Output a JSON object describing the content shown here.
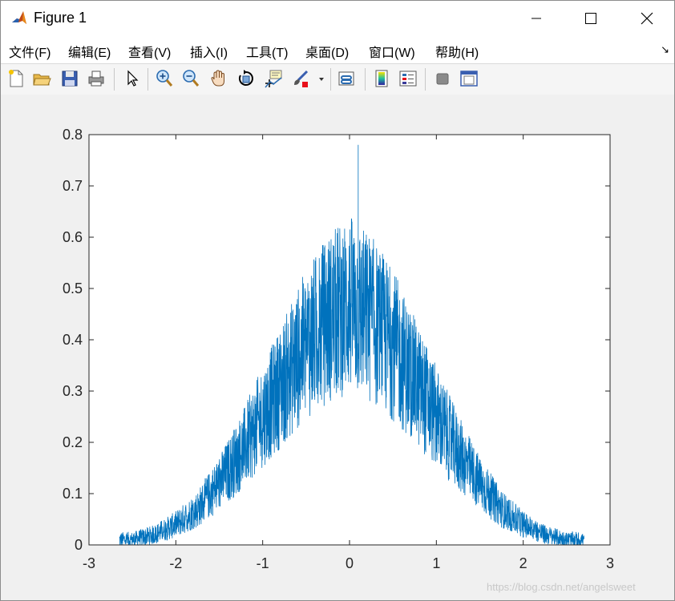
{
  "window": {
    "title": "Figure 1",
    "controls": [
      "minimize-icon",
      "maximize-icon",
      "close-icon"
    ]
  },
  "menubar": {
    "items": [
      {
        "label": "文件(F)"
      },
      {
        "label": "编辑(E)"
      },
      {
        "label": "查看(V)"
      },
      {
        "label": "插入(I)"
      },
      {
        "label": "工具(T)"
      },
      {
        "label": "桌面(D)"
      },
      {
        "label": "窗口(W)"
      },
      {
        "label": "帮助(H)"
      }
    ],
    "dock_arrow": "↘"
  },
  "toolbar": {
    "icons": [
      "new-figure-icon",
      "open-file-icon",
      "save-icon",
      "print-icon",
      "edit-plot-icon",
      "zoom-in-icon",
      "zoom-out-icon",
      "pan-icon",
      "rotate-3d-icon",
      "data-cursor-icon",
      "brush-icon",
      "brush-dropdown-icon",
      "link-plot-icon",
      "insert-colorbar-icon",
      "insert-legend-icon",
      "hide-plot-tools-icon",
      "show-plot-tools-icon"
    ]
  },
  "chart_data": {
    "type": "line",
    "title": "",
    "xlabel": "",
    "ylabel": "",
    "xlim": [
      -3,
      3
    ],
    "ylim": [
      0,
      0.8
    ],
    "xticks": [
      "-3",
      "-2",
      "-1",
      "0",
      "1",
      "2",
      "3"
    ],
    "yticks": [
      "0",
      "0.1",
      "0.2",
      "0.3",
      "0.4",
      "0.5",
      "0.6",
      "0.7",
      "0.8"
    ],
    "grid": false,
    "line_color": "#0072BD",
    "series": [
      {
        "x": [
          -2.65,
          -2.5,
          -2.25,
          -2.0,
          -1.75,
          -1.5,
          -1.25,
          -1.0,
          -0.75,
          -0.5,
          -0.25,
          0.0,
          0.25,
          0.5,
          0.75,
          1.0,
          1.25,
          1.5,
          1.75,
          2.0,
          2.25,
          2.5,
          2.7
        ],
        "values": [
          0.01,
          0.01,
          0.02,
          0.04,
          0.07,
          0.12,
          0.18,
          0.25,
          0.32,
          0.39,
          0.44,
          0.47,
          0.44,
          0.39,
          0.32,
          0.25,
          0.18,
          0.12,
          0.07,
          0.04,
          0.02,
          0.01,
          0.01
        ],
        "noise_peak": 0.78
      }
    ]
  },
  "watermark": "https://blog.csdn.net/angelsweet"
}
